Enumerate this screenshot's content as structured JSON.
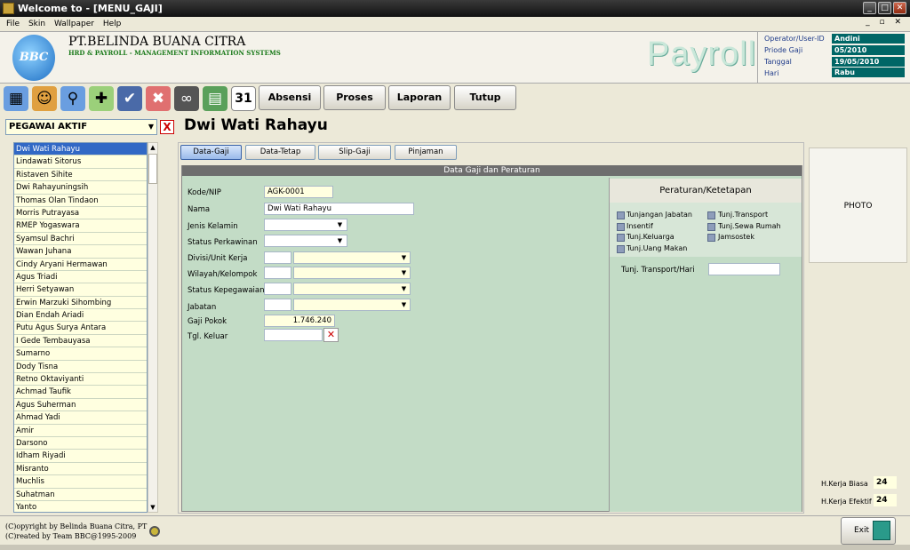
{
  "window": {
    "title": "Welcome to - [MENU_GAJI]",
    "min": "_",
    "max": "□",
    "close": "✕",
    "mdi_controls": "_ ▫ ✕"
  },
  "menu": [
    "File",
    "Skin",
    "Wallpaper",
    "Help"
  ],
  "header": {
    "logo": "BBC",
    "company": "PT.BELINDA BUANA CITRA",
    "subtitle": "HRD & PAYROLL - MANAGEMENT INFORMATION SYSTEMS",
    "app_name": "Payroll"
  },
  "info": {
    "operator_label": "Operator/User-ID",
    "operator": "Andini",
    "periode_label": "Priode Gaji",
    "periode": "05/2010",
    "tanggal_label": "Tanggal",
    "tanggal": "19/05/2010",
    "hari_label": "Hari",
    "hari": "Rabu"
  },
  "toolbar": {
    "icons": [
      "window-icon",
      "user-icon",
      "users-search-icon",
      "user-add-icon",
      "save-icon",
      "user-delete-icon",
      "binoculars-icon",
      "calculator-icon",
      "calendar-icon"
    ],
    "calendar_day": "31",
    "buttons": [
      "Absensi",
      "Proses",
      "Laporan",
      "Tutup"
    ]
  },
  "employee_filter": {
    "value": "PEGAWAI AKTIF",
    "arrow": "▼",
    "clear": "X"
  },
  "employees": [
    "Dwi Wati Rahayu",
    "Lindawati Sitorus",
    "Ristaven Sihite",
    "Dwi Rahayuningsih",
    "Thomas Olan Tindaon",
    "Morris Putrayasa",
    "RMEP Yogaswara",
    "Syamsul Bachri",
    "Wawan Juhana",
    "Cindy Aryani Hermawan",
    "Agus Triadi",
    "Herri Setyawan",
    "Erwin Marzuki Sihombing",
    "Dian Endah Ariadi",
    "Putu Agus Surya Antara",
    "I Gede Tembauyasa",
    "Sumarno",
    "Dody Tisna",
    "Retno Oktaviyanti",
    "Achmad Taufik",
    "Agus Suherman",
    "Ahmad Yadi",
    "Amir",
    "Darsono",
    "Idham Riyadi",
    "Misranto",
    "Muchlis",
    "Suhatman",
    "Yanto"
  ],
  "scroll": {
    "up": "▲",
    "down": "▼"
  },
  "selected_employee": "Dwi Wati Rahayu",
  "tabs": [
    "Data-Gaji",
    "Data-Tetap",
    "Slip-Gaji",
    "Pinjaman"
  ],
  "data_section": {
    "title": "Data Gaji dan Peraturan"
  },
  "form": {
    "kode_label": "Kode/NIP",
    "kode": "AGK-0001",
    "nama_label": "Nama",
    "nama": "Dwi Wati Rahayu",
    "jenis_kelamin_label": "Jenis Kelamin",
    "status_perkawinan_label": "Status Perkawinan",
    "divisi_label": "Divisi/Unit Kerja",
    "wilayah_label": "Wilayah/Kelompok",
    "status_kepegawaian_label": "Status Kepegawaian",
    "jabatan_label": "Jabatan",
    "gaji_pokok_label": "Gaji Pokok",
    "gaji_pokok": "1.746.240",
    "tgl_keluar_label": "Tgl. Keluar",
    "dd_arrow": "▼",
    "clear": "✕"
  },
  "rules": {
    "title": "Peraturan/Ketetapan",
    "checks_left": [
      "Tunjangan Jabatan",
      "Insentif",
      "Tunj.Keluarga",
      "Tunj.Uang Makan"
    ],
    "checks_right": [
      "Tunj.Transport",
      "Tunj.Sewa Rumah",
      "Jamsostek"
    ],
    "transport_label": "Tunj. Transport/Hari"
  },
  "photo": "PHOTO",
  "hari_kerja": {
    "biasa_label": "H.Kerja Biasa",
    "biasa": "24",
    "efektif_label": "H.Kerja Efektif",
    "efektif": "24"
  },
  "footer": {
    "copyright": "(C)opyright by Belinda Buana Citra, PT",
    "created": "(C)reated by Team BBC@1995-2009",
    "exit": "Exit"
  },
  "colors": {
    "accent": "#3168c5",
    "panel_green": "#c3dcc6",
    "info_teal": "#006666",
    "list_yellow": "#ffffe0"
  }
}
